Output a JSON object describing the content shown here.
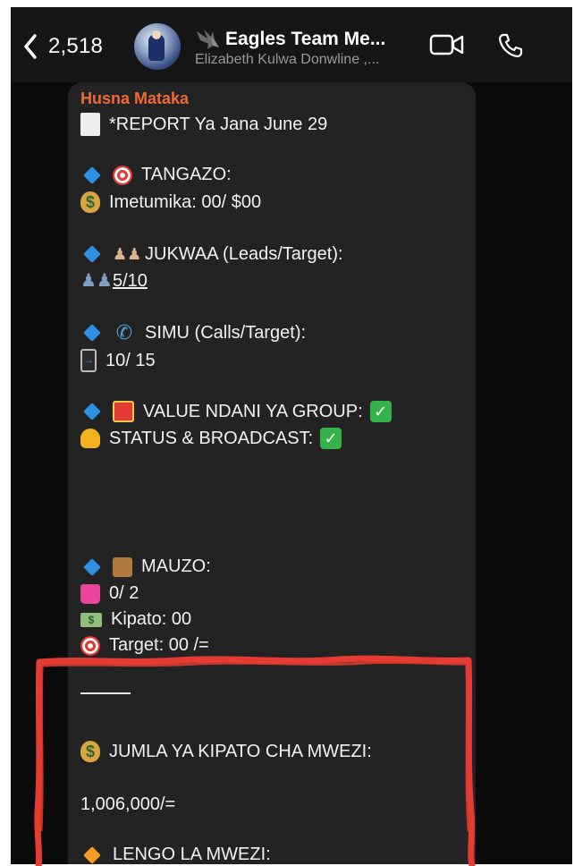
{
  "header": {
    "back_count": "2,518",
    "title": "Eagles Team Me...",
    "subtitle": "Elizabeth Kulwa Donwline ,..."
  },
  "message": {
    "sender": "Husna Mataka",
    "lines": {
      "report": "*REPORT Ya Jana June 29",
      "tangazo": "TANGAZO:",
      "imetumika": "Imetumika: 00/ $00",
      "jukwaa": "JUKWAA (Leads/Target):",
      "jukwaa_value": "5/10",
      "simu": "SIMU (Calls/Target):",
      "simu_value": "10/ 15",
      "value_group": "VALUE NDANI YA GROUP:",
      "status": "STATUS & BROADCAST:",
      "mauzo": "MAUZO:",
      "mauzo_value": "0/ 2",
      "kipato": "Kipato: 00",
      "target": "Target: 00 /=",
      "jumla": "JUMLA YA KIPATO CHA MWEZI:",
      "jumla_value": "1,006,000/=",
      "lengo": "LENGO LA MWEZI:"
    }
  },
  "colors": {
    "sender": "#f06a34",
    "bubble": "#232323",
    "background": "#0b0b0b",
    "annotation": "#e53b30"
  }
}
